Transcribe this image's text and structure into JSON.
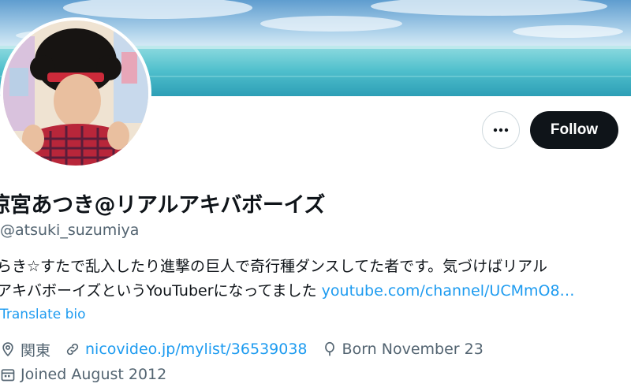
{
  "profile": {
    "display_name": "涼宮あつき@リアルアキバボーイズ",
    "handle": "@atsuki_suzumiya",
    "bio_text_line1": "らき☆すたで乱入したり進撃の巨人で奇行種ダンスしてた者です。気づけばリアル",
    "bio_text_line2": "アキバボーイズというYouTuberになってました ",
    "bio_link": "youtube.com/channel/UCMmO8…",
    "translate_label": "Translate bio",
    "location": "関東",
    "website": "nicovideo.jp/mylist/36539038",
    "birthday": "Born November 23",
    "joined": "Joined August 2012"
  },
  "actions": {
    "follow_label": "Follow",
    "more_icon": "more-horizontal-icon"
  },
  "colors": {
    "accent": "#1d9bf0",
    "text": "#0f1419",
    "secondary_text": "#536471",
    "follow_bg": "#0f1419"
  }
}
